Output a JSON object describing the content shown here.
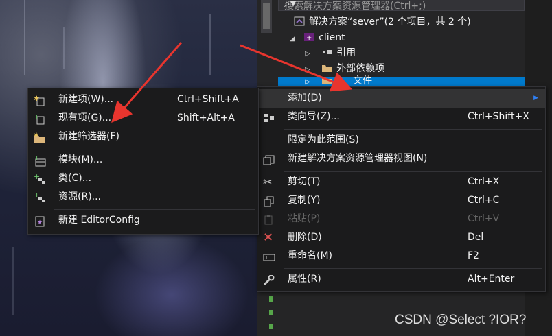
{
  "search": {
    "placeholder": "搜索解决方案资源管理器(Ctrl+;)"
  },
  "solution_tree": {
    "solution_label": "解决方案“sever”(2 个项目，共 2 个)",
    "project_label": "client",
    "items": [
      {
        "label": "引用"
      },
      {
        "label": "外部依赖项"
      },
      {
        "label": "文件"
      }
    ]
  },
  "context_menu": {
    "items": [
      {
        "label": "添加(D)",
        "shortcut": ""
      },
      {
        "label": "类向导(Z)...",
        "shortcut": "Ctrl+Shift+X"
      },
      {
        "label": "限定为此范围(S)",
        "shortcut": ""
      },
      {
        "label": "新建解决方案资源管理器视图(N)",
        "shortcut": ""
      },
      {
        "label": "剪切(T)",
        "shortcut": "Ctrl+X"
      },
      {
        "label": "复制(Y)",
        "shortcut": "Ctrl+C"
      },
      {
        "label": "粘贴(P)",
        "shortcut": "Ctrl+V"
      },
      {
        "label": "删除(D)",
        "shortcut": "Del"
      },
      {
        "label": "重命名(M)",
        "shortcut": "F2"
      },
      {
        "label": "属性(R)",
        "shortcut": "Alt+Enter"
      }
    ]
  },
  "add_submenu": {
    "items": [
      {
        "label": "新建项(W)...",
        "shortcut": "Ctrl+Shift+A"
      },
      {
        "label": "现有项(G)...",
        "shortcut": "Shift+Alt+A"
      },
      {
        "label": "新建筛选器(F)",
        "shortcut": ""
      },
      {
        "label": "模块(M)...",
        "shortcut": ""
      },
      {
        "label": "类(C)...",
        "shortcut": ""
      },
      {
        "label": "资源(R)...",
        "shortcut": ""
      },
      {
        "label": "新建 EditorConfig",
        "shortcut": ""
      }
    ]
  },
  "watermark": "CSDN @Select ?IOR?",
  "colors": {
    "accent": "#007acc",
    "annotation_arrow": "#e8352e",
    "menu_bg": "#1b1b1c"
  }
}
